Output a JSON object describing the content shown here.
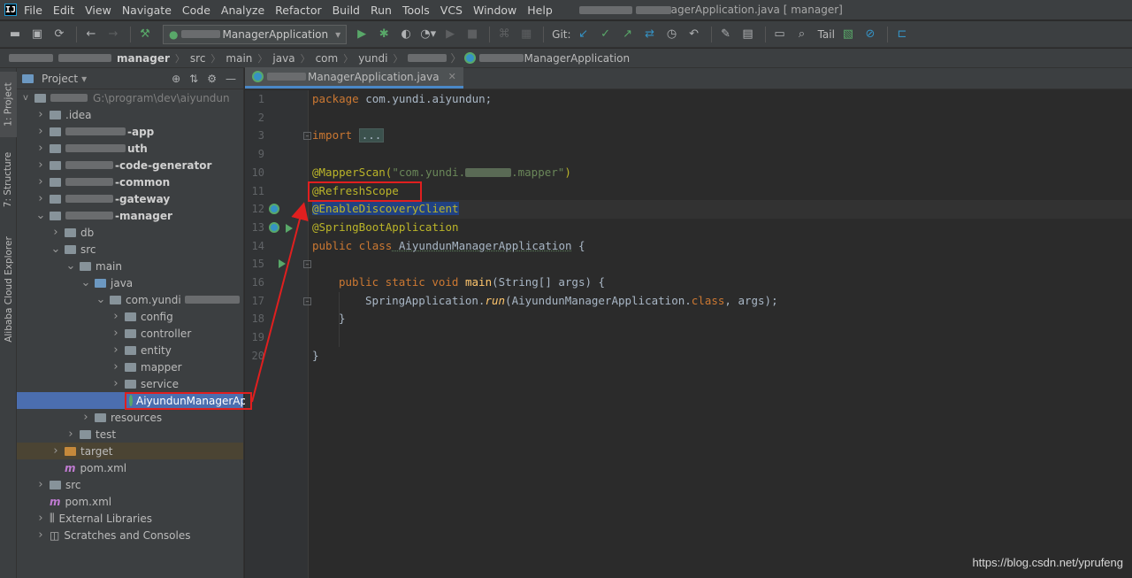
{
  "menubar": {
    "items": [
      "File",
      "Edit",
      "View",
      "Navigate",
      "Code",
      "Analyze",
      "Refactor",
      "Build",
      "Run",
      "Tools",
      "VCS",
      "Window",
      "Help"
    ],
    "window_title": "agerApplication.java [  manager]"
  },
  "toolbar": {
    "run_config": "ManagerApplication",
    "git_label": "Git:",
    "tail_label": "Tail"
  },
  "breadcrumbs": [
    "manager",
    "src",
    "main",
    "java",
    "com",
    "yundi",
    "ManagerApplication"
  ],
  "project_panel": {
    "title": "Project",
    "root_path": "G:\\program\\dev\\aiyundun",
    "tree": [
      {
        "label": ".idea",
        "indent": 1,
        "arrow": ">",
        "icon": "folder"
      },
      {
        "label": "-app",
        "indent": 1,
        "arrow": ">",
        "icon": "folder",
        "bold": true
      },
      {
        "label": "uth",
        "indent": 1,
        "arrow": ">",
        "icon": "folder",
        "bold": true
      },
      {
        "label": "-code-generator",
        "indent": 1,
        "arrow": ">",
        "icon": "folder",
        "bold": true
      },
      {
        "label": "-common",
        "indent": 1,
        "arrow": ">",
        "icon": "folder",
        "bold": true
      },
      {
        "label": "-gateway",
        "indent": 1,
        "arrow": ">",
        "icon": "folder",
        "bold": true
      },
      {
        "label": "-manager",
        "indent": 1,
        "arrow": "v",
        "icon": "folder",
        "bold": true
      },
      {
        "label": "db",
        "indent": 2,
        "arrow": ">",
        "icon": "folder"
      },
      {
        "label": "src",
        "indent": 2,
        "arrow": "v",
        "icon": "folder"
      },
      {
        "label": "main",
        "indent": 3,
        "arrow": "v",
        "icon": "folder"
      },
      {
        "label": "java",
        "indent": 4,
        "arrow": "v",
        "icon": "folder-blue"
      },
      {
        "label": "com.yundi",
        "indent": 5,
        "arrow": "v",
        "icon": "folder"
      },
      {
        "label": "config",
        "indent": 6,
        "arrow": ">",
        "icon": "folder"
      },
      {
        "label": "controller",
        "indent": 6,
        "arrow": ">",
        "icon": "folder"
      },
      {
        "label": "entity",
        "indent": 6,
        "arrow": ">",
        "icon": "folder"
      },
      {
        "label": "mapper",
        "indent": 6,
        "arrow": ">",
        "icon": "folder"
      },
      {
        "label": "service",
        "indent": 6,
        "arrow": ">",
        "icon": "folder"
      },
      {
        "label": "AiyundunManagerAp",
        "indent": 7,
        "arrow": "",
        "icon": "spring-class",
        "selected": true
      },
      {
        "label": "resources",
        "indent": 4,
        "arrow": ">",
        "icon": "folder"
      },
      {
        "label": "test",
        "indent": 3,
        "arrow": ">",
        "icon": "folder"
      },
      {
        "label": "target",
        "indent": 2,
        "arrow": ">",
        "icon": "folder-orange",
        "target": true
      },
      {
        "label": "pom.xml",
        "indent": 2,
        "arrow": "",
        "icon": "maven"
      },
      {
        "label": "src",
        "indent": 1,
        "arrow": ">",
        "icon": "folder"
      },
      {
        "label": "pom.xml",
        "indent": 1,
        "arrow": "",
        "icon": "maven"
      },
      {
        "label": "External Libraries",
        "indent": 1,
        "arrow": ">",
        "icon": "library"
      },
      {
        "label": "Scratches and Consoles",
        "indent": 1,
        "arrow": ">",
        "icon": "scratches"
      }
    ]
  },
  "side_tabs": [
    "1: Project",
    "7: Structure",
    "Alibaba Cloud Explorer"
  ],
  "editor": {
    "tab_label": "ManagerApplication.java",
    "line_numbers": [
      "1",
      "2",
      "3",
      "9",
      "10",
      "11",
      "12",
      "13",
      "14",
      "15",
      "16",
      "17",
      "18",
      "19",
      "20"
    ],
    "lines": {
      "l1_kw": "package",
      "l1_rest": " com.yundi.aiyundun;",
      "l3_kw": "import",
      "l3_fold": "...",
      "l9_ann": "@MapperScan(",
      "l9_str": "\"com.yundi.",
      "l9_str2": ".mapper\"",
      "l9_end": ")",
      "l10": "@RefreshScope",
      "l11": "@EnableDiscoveryClient",
      "l12": "@SpringBootApplication",
      "l13_kw": "public class",
      "l13_name": " AiyundunManagerApplication",
      "l13_end": " {",
      "l15_kw": "public static void",
      "l15_fn": " main",
      "l15_rest": "(String[] args) {",
      "l16_a": "SpringApplication.",
      "l16_b": "run",
      "l16_c": "(AiyundunManagerApplication.",
      "l16_d": "class",
      "l16_e": ", args);",
      "l17": "}",
      "l19": "}"
    }
  },
  "watermark": "https://blog.csdn.net/yprufeng",
  "colors": {
    "keyword": "#cc7832",
    "annotation": "#bbb529",
    "string": "#6a8759",
    "highlight": "#e01f1f",
    "selection": "#4b6eaf"
  }
}
